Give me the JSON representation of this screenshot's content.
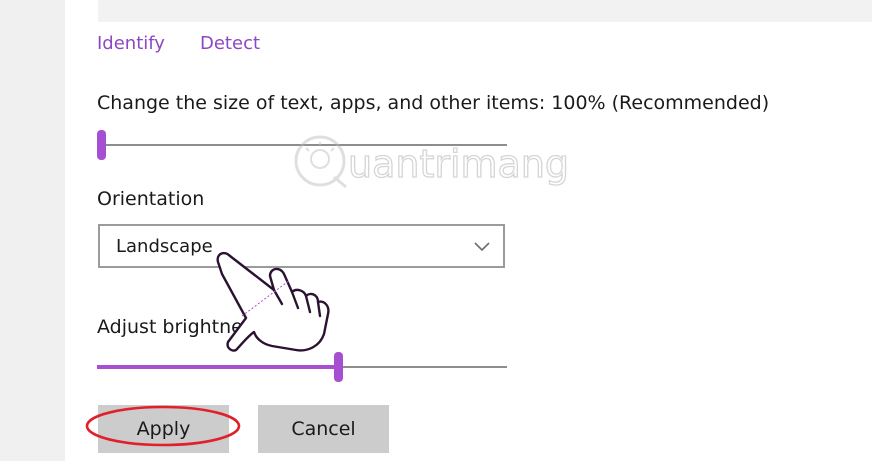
{
  "links": {
    "identify": "Identify",
    "detect": "Detect"
  },
  "scale": {
    "label": "Change the size of text, apps, and other items: 100% (Recommended)",
    "slider_value": 0.0
  },
  "orientation": {
    "label": "Orientation",
    "selected": "Landscape"
  },
  "brightness": {
    "label": "Adjust brightne",
    "slider_value": 0.59
  },
  "buttons": {
    "apply": "Apply",
    "cancel": "Cancel"
  },
  "watermark": {
    "text": "uantrimang"
  },
  "colors": {
    "accent": "#a64fd0",
    "link": "#8e47c2",
    "annotation_circle": "#e0202a",
    "button_bg": "#cccccc"
  },
  "icons": {
    "dropdown": "chevron-down-icon",
    "pointer": "pointing-hand-icon",
    "watermark_logo": "lightbulb-q-icon"
  }
}
